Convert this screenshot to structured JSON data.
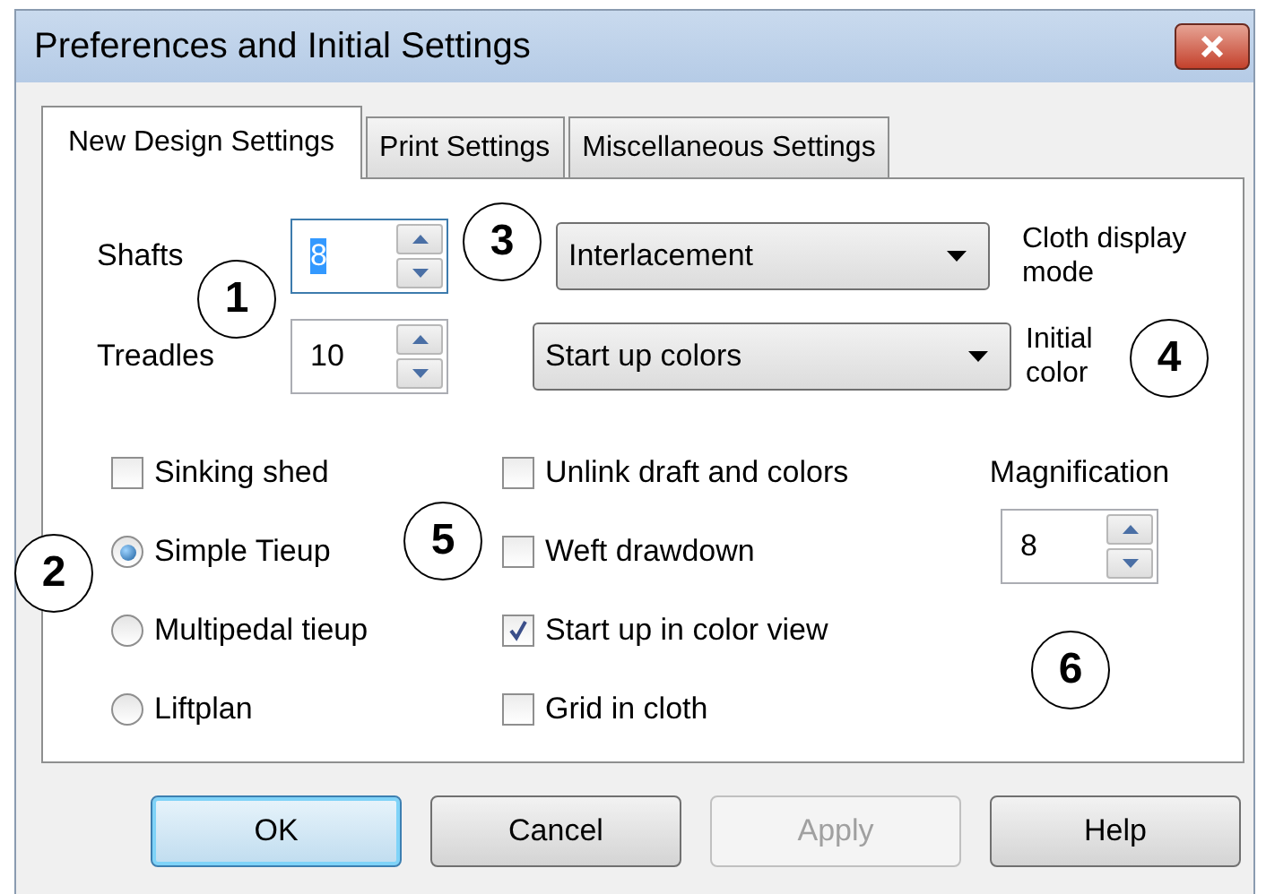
{
  "window": {
    "title": "Preferences and Initial Settings"
  },
  "tabs": [
    {
      "label": "New Design Settings",
      "selected": true
    },
    {
      "label": "Print Settings",
      "selected": false
    },
    {
      "label": "Miscellaneous Settings",
      "selected": false
    }
  ],
  "shafts": {
    "label": "Shafts",
    "value": "8",
    "selected": true
  },
  "treadles": {
    "label": "Treadles",
    "value": "10",
    "selected": false
  },
  "cloth_display_mode": {
    "value": "Interlacement",
    "label": "Cloth display mode"
  },
  "initial_color": {
    "value": "Start up colors",
    "label": "Initial color"
  },
  "options_left": [
    {
      "kind": "checkbox",
      "label": "Sinking shed",
      "checked": false
    },
    {
      "kind": "radio",
      "label": "Simple Tieup",
      "selected": true
    },
    {
      "kind": "radio",
      "label": "Multipedal tieup",
      "selected": false
    },
    {
      "kind": "radio",
      "label": "Liftplan",
      "selected": false
    }
  ],
  "options_middle": [
    {
      "kind": "checkbox",
      "label": "Unlink draft and colors",
      "checked": false
    },
    {
      "kind": "checkbox",
      "label": "Weft drawdown",
      "checked": false
    },
    {
      "kind": "checkbox",
      "label": "Start up in color view",
      "checked": true
    },
    {
      "kind": "checkbox",
      "label": "Grid in cloth",
      "checked": false
    }
  ],
  "magnification": {
    "label": "Magnification",
    "value": "8"
  },
  "callouts": [
    "1",
    "2",
    "3",
    "4",
    "5",
    "6"
  ],
  "buttons": [
    {
      "label": "OK",
      "default": true,
      "disabled": false
    },
    {
      "label": "Cancel",
      "default": false,
      "disabled": false
    },
    {
      "label": "Apply",
      "default": false,
      "disabled": true
    },
    {
      "label": "Help",
      "default": false,
      "disabled": false
    }
  ]
}
